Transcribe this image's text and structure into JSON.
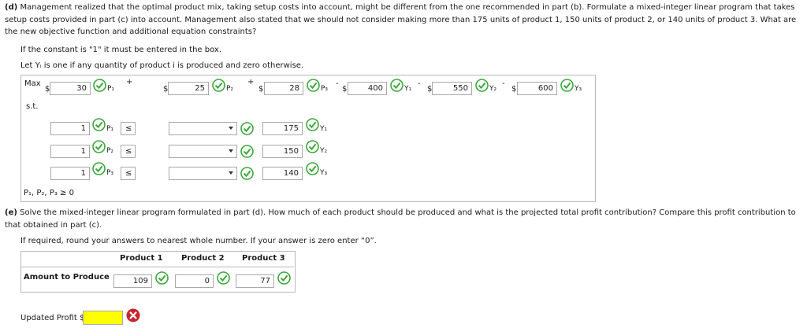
{
  "part_d": {
    "lead": "(d)",
    "text": "Management realized that the optimal product mix, taking setup costs into account, might be different from the one recommended in part (b). Formulate a mixed-integer linear program that takes setup costs provided in part (c) into account. Management also stated that we should not consider making more than 175 units of product 1, 150 units of product 2, or 140 units of product 3. What are the new objective function and additional equation constraints?",
    "note": "If the constant is \"1\" it must be entered in the box.",
    "let": "Let Yᵢ is one if any quantity of product i is produced and zero otherwise."
  },
  "objective": {
    "max_label": "Max",
    "dollar": "$",
    "plus": "+",
    "minus": "-",
    "coef_p1": "30",
    "coef_p2": "25",
    "coef_p3": "28",
    "coef_y1": "400",
    "coef_y2": "550",
    "coef_y3": "600",
    "var_p1": "P₁",
    "var_p2": "P₂",
    "var_p3": "P₃",
    "var_y1": "Y₁",
    "var_y2": "Y₂",
    "var_y3": "Y₃"
  },
  "constraints": {
    "st_label": "s.t.",
    "rows": [
      {
        "coef": "1",
        "var": "P₁",
        "op": "≤",
        "rhs": "175",
        "yvar": "Y₁"
      },
      {
        "coef": "1",
        "var": "P₂",
        "op": "≤",
        "rhs": "150",
        "yvar": "Y₂"
      },
      {
        "coef": "1",
        "var": "P₃",
        "op": "≤",
        "rhs": "140",
        "yvar": "Y₃"
      }
    ],
    "nonneg": "P₁, P₂, P₃ ≥ 0"
  },
  "part_e": {
    "lead": "(e)",
    "text": "Solve the mixed-integer linear program formulated in part (d). How much of each product should be produced and what is the projected total profit contribution? Compare this profit contribution to that obtained in part (c).",
    "note": "If required, round your answers to nearest whole number. If your answer is zero enter “0”."
  },
  "results_table": {
    "headers": [
      "Product 1",
      "Product 2",
      "Product 3"
    ],
    "row_label": "Amount to Produce",
    "values": [
      "109",
      "0",
      "77"
    ]
  },
  "updated_profit": {
    "label": "Updated Profit $",
    "value": ""
  },
  "colors": {
    "correct": "#3aa83a",
    "incorrect": "#c8252c",
    "highlight": "#ffff00"
  }
}
